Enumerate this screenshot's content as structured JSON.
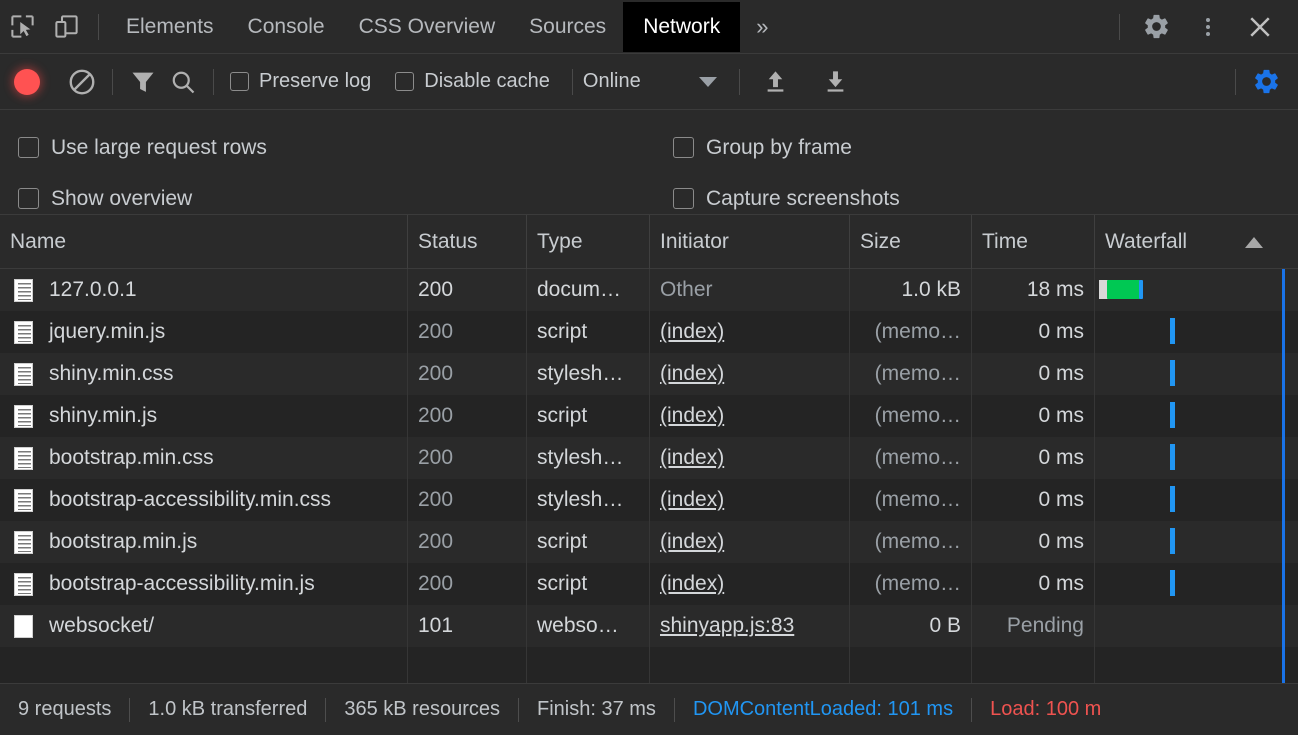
{
  "tabbar": {
    "inspect_icon": "inspect-element-icon",
    "device_icon": "device-toolbar-icon",
    "tabs": [
      {
        "label": "Elements",
        "active": false
      },
      {
        "label": "Console",
        "active": false
      },
      {
        "label": "CSS Overview",
        "active": false
      },
      {
        "label": "Sources",
        "active": false
      },
      {
        "label": "Network",
        "active": true
      }
    ],
    "more_tabs_label": "»",
    "settings_icon": "gear-icon",
    "kebab_icon": "more-options-icon",
    "close_icon": "close-icon"
  },
  "toolbar": {
    "record_label": "record-button",
    "clear_label": "clear-button",
    "filter_label": "filter-button",
    "search_label": "search-button",
    "preserve_log": "Preserve log",
    "disable_cache": "Disable cache",
    "throttle_value": "Online",
    "import_har": "import-har-icon",
    "export_har": "export-har-icon",
    "network_settings": "network-settings-icon",
    "accent_blue": "#1a73e8"
  },
  "settings": {
    "use_large_request_rows": "Use large request rows",
    "group_by_frame": "Group by frame",
    "show_overview": "Show overview",
    "capture_screenshots": "Capture screenshots"
  },
  "table": {
    "headers": {
      "name": "Name",
      "status": "Status",
      "type": "Type",
      "initiator": "Initiator",
      "size": "Size",
      "time": "Time",
      "waterfall": "Waterfall"
    },
    "sort_direction": "ascending",
    "rows": [
      {
        "name": "127.0.0.1",
        "status": "200",
        "type": "docum…",
        "initiator": "Other",
        "size": "1.0 kB",
        "time": "18 ms",
        "icon": "document-icon",
        "status_dim": false,
        "initiator_link": false,
        "initiator_dim": true,
        "size_dim": false,
        "time_dim": false,
        "wf_type": "green-bar"
      },
      {
        "name": "jquery.min.js",
        "status": "200",
        "type": "script",
        "initiator": "(index)",
        "size": "(memo…",
        "time": "0 ms",
        "icon": "document-icon",
        "status_dim": true,
        "initiator_link": true,
        "initiator_dim": false,
        "size_dim": true,
        "time_dim": false,
        "wf_type": "blue-tick"
      },
      {
        "name": "shiny.min.css",
        "status": "200",
        "type": "stylesh…",
        "initiator": "(index)",
        "size": "(memo…",
        "time": "0 ms",
        "icon": "document-icon",
        "status_dim": true,
        "initiator_link": true,
        "initiator_dim": false,
        "size_dim": true,
        "time_dim": false,
        "wf_type": "blue-tick"
      },
      {
        "name": "shiny.min.js",
        "status": "200",
        "type": "script",
        "initiator": "(index)",
        "size": "(memo…",
        "time": "0 ms",
        "icon": "document-icon",
        "status_dim": true,
        "initiator_link": true,
        "initiator_dim": false,
        "size_dim": true,
        "time_dim": false,
        "wf_type": "blue-tick"
      },
      {
        "name": "bootstrap.min.css",
        "status": "200",
        "type": "stylesh…",
        "initiator": "(index)",
        "size": "(memo…",
        "time": "0 ms",
        "icon": "document-icon",
        "status_dim": true,
        "initiator_link": true,
        "initiator_dim": false,
        "size_dim": true,
        "time_dim": false,
        "wf_type": "blue-tick"
      },
      {
        "name": "bootstrap-accessibility.min.css",
        "status": "200",
        "type": "stylesh…",
        "initiator": "(index)",
        "size": "(memo…",
        "time": "0 ms",
        "icon": "document-icon",
        "status_dim": true,
        "initiator_link": true,
        "initiator_dim": false,
        "size_dim": true,
        "time_dim": false,
        "wf_type": "blue-tick"
      },
      {
        "name": "bootstrap.min.js",
        "status": "200",
        "type": "script",
        "initiator": "(index)",
        "size": "(memo…",
        "time": "0 ms",
        "icon": "document-icon",
        "status_dim": true,
        "initiator_link": true,
        "initiator_dim": false,
        "size_dim": true,
        "time_dim": false,
        "wf_type": "blue-tick"
      },
      {
        "name": "bootstrap-accessibility.min.js",
        "status": "200",
        "type": "script",
        "initiator": "(index)",
        "size": "(memo…",
        "time": "0 ms",
        "icon": "document-icon",
        "status_dim": true,
        "initiator_link": true,
        "initiator_dim": false,
        "size_dim": true,
        "time_dim": false,
        "wf_type": "blue-tick"
      },
      {
        "name": "websocket/",
        "status": "101",
        "type": "webso…",
        "initiator": "shinyapp.js:83",
        "size": "0 B",
        "time": "Pending",
        "icon": "blank-file-icon",
        "status_dim": false,
        "initiator_link": true,
        "initiator_dim": false,
        "size_dim": false,
        "time_dim": true,
        "wf_type": "none"
      }
    ]
  },
  "statusbar": {
    "requests": "9 requests",
    "transferred": "1.0 kB transferred",
    "resources": "365 kB resources",
    "finish": "Finish: 37 ms",
    "dom_content_loaded": "DOMContentLoaded: 101 ms",
    "load": "Load: 100 m",
    "dcl_color": "#2196f3",
    "load_color": "#ef5350"
  }
}
